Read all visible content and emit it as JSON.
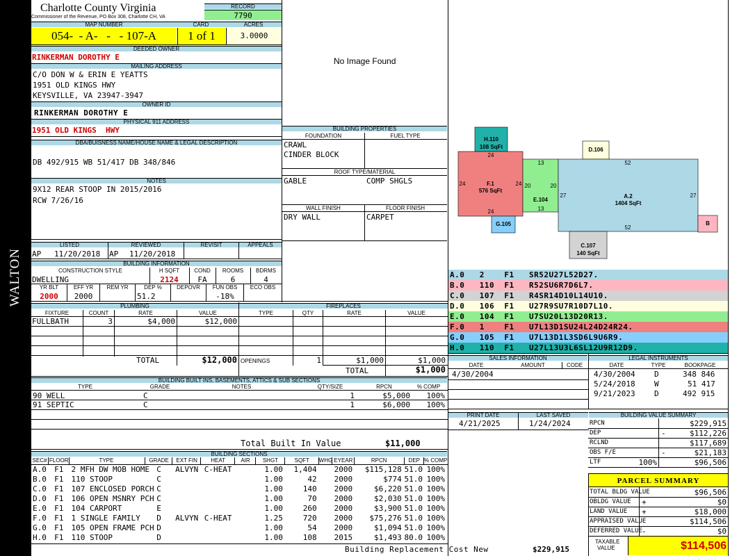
{
  "sidebar_label": "WALTON",
  "header": {
    "county": "Charlotte County Virginia",
    "commissioner": "Commissioner of the Revenue, PO Box 308, Charlotte CH, VA",
    "record_label": "RECORD",
    "record": "7790",
    "map_label": "MAP NUMBER",
    "map_number": "054-  - A-   -   - 107-A",
    "card_label": "CARD",
    "card": "1 of 1",
    "acres_label": "ACRES",
    "acres": "3.0000"
  },
  "owner": {
    "deeded_label": "DEEDED OWNER",
    "deeded": "RINKERMAN DOROTHY E",
    "mailing_label": "MAILING ADDRESS",
    "mailing": [
      "C/O DON W & ERIN E YEATTS",
      "1951 OLD KINGS HWY",
      "KEYSVILLE, VA 23947-3947"
    ],
    "owner_id_label": "OWNER ID",
    "owner_id": "RINKERMAN DOROTHY E",
    "physical_label": "PHYSICAL 911 ADDRESS",
    "physical": "1951 OLD KINGS  HWY",
    "dba_label": "DBA/BUISNESS NAME/HOUSE NAME & LEGAL DESCRIPTION",
    "dba": "DB 492/915 WB 51/417 DB 348/846",
    "notes_label": "NOTES",
    "notes": [
      "9X12 REAR STOOP IN 2015/2016",
      "RCW 7/26/16"
    ]
  },
  "image_placeholder": "No Image Found",
  "building_properties": {
    "title": "BUILDING PROPERTIES",
    "foundation_label": "FOUNDATION",
    "fuel_label": "FUEL TYPE",
    "foundation": [
      "CRAWL",
      "CINDER BLOCK"
    ],
    "roof_label": "ROOF TYPE/MATERIAL",
    "roof_type": "GABLE",
    "roof_material": "COMP SHGLS",
    "wall_label": "WALL FINISH",
    "floor_label": "FLOOR FINISH",
    "wall": "DRY WALL",
    "floor": "CARPET"
  },
  "dates": {
    "listed_label": "LISTED",
    "reviewed_label": "REVIEWED",
    "revisit_label": "REVISIT",
    "appeals_label": "APPEALS",
    "listed_by": "AP",
    "listed": "11/20/2018",
    "reviewed_by": "AP",
    "reviewed": "11/20/2018"
  },
  "building_info": {
    "title": "BUILDING INFORMATION",
    "style_label": "CONSTRUCTION STYLE",
    "hsqft_label": "H SQFT",
    "cond_label": "COND",
    "rooms_label": "ROOMS",
    "bdrms_label": "BDRMS",
    "style": "DWELLING",
    "hsqft": "2124",
    "cond": "FA",
    "rooms": "6",
    "bdrms": "4",
    "yrblt_label": "YR BLT",
    "effyr_label": "EFF YR",
    "remyr_label": "REM YR",
    "dep_label": "DEP %",
    "depovr_label": "DEPOVR",
    "funobs_label": "FUN OBS",
    "ecoobs_label": "ECO OBS",
    "yrblt": "2000",
    "effyr": "2000",
    "dep": "51.2",
    "funobs": "-18%"
  },
  "plumbing": {
    "title": "PLUMBING",
    "cols": [
      "FIXTURE",
      "COUNT",
      "RATE",
      "VALUE"
    ],
    "rows": [
      [
        "FULLBATH",
        "3",
        "$4,000",
        "$12,000"
      ]
    ],
    "total_label": "TOTAL",
    "total": "$12,000"
  },
  "fireplaces": {
    "title": "FIREPLACES",
    "cols": [
      "TYPE",
      "QTY",
      "RATE",
      "VALUE"
    ],
    "openings_label": "OPENINGS",
    "openings_qty": "1",
    "openings_rate": "$1,000",
    "openings_value": "$1,000",
    "total_label": "TOTAL",
    "total": "$1,000"
  },
  "sketch": {
    "labels": [
      {
        "code": "H.110",
        "area": "108 SqFt"
      },
      {
        "code": "D.106",
        "area": ""
      },
      {
        "code": "F.1",
        "area": "576 SqFt"
      },
      {
        "code": "E.104",
        "area": ""
      },
      {
        "code": "A.2",
        "area": "1404 SqFt"
      },
      {
        "code": "G.105",
        "area": ""
      },
      {
        "code": "B",
        "area": ""
      },
      {
        "code": "C.107",
        "area": "140 SqFt"
      }
    ],
    "dims": [
      "24",
      "24",
      "24",
      "24",
      "13",
      "13",
      "20",
      "20",
      "52",
      "52",
      "27",
      "27"
    ]
  },
  "sketch_legend": [
    {
      "text": "A.0   2    F1   SR52U27L52D27.",
      "color": "#add8e6"
    },
    {
      "text": "B.0   110  F1   R52SU6R7D6L7.",
      "color": "#ffb6c1"
    },
    {
      "text": "C.0   107  F1   R4SR14D10L14U10.",
      "color": "#d3d3d3"
    },
    {
      "text": "D.0   106  F1   U27R9SU7R10D7L10.",
      "color": "#ffffe0"
    },
    {
      "text": "E.0   104  F1   U7SU20L13D20R13.",
      "color": "#90ee90"
    },
    {
      "text": "F.0   1    F1   U7L13D1SU24L24D24R24.",
      "color": "#f08080"
    },
    {
      "text": "G.0   105  F1   U7L13D1L3SD6L9U6R9.",
      "color": "#87cefa"
    },
    {
      "text": "H.0   110  F1   U27L13U3L6SL12U9R12D9.",
      "color": "#20b2aa"
    }
  ],
  "sales": {
    "title": "SALES INFORMATION",
    "cols": [
      "DATE",
      "AMOUNT",
      "CODE"
    ],
    "rows": [
      [
        "4/30/2004",
        "",
        ""
      ]
    ]
  },
  "legal": {
    "title": "LEGAL INSTRUMENTS",
    "cols": [
      "DATE",
      "TYPE",
      "BOOKPAGE"
    ],
    "rows": [
      [
        "4/30/2004",
        "D",
        "348 846"
      ],
      [
        "5/24/2018",
        "W",
        "51 417"
      ],
      [
        "9/21/2023",
        "D",
        "492 915"
      ]
    ]
  },
  "print": {
    "print_label": "PRINT DATE",
    "saved_label": "LAST SAVED",
    "print_date": "4/21/2025",
    "saved_date": "1/24/2024"
  },
  "value_summary": {
    "title": "BUILDING VALUE SUMMARY",
    "rows": [
      {
        "label": "RPCN",
        "sign": "",
        "pct": "",
        "value": "$229,915"
      },
      {
        "label": "DEP",
        "sign": "-",
        "pct": "",
        "value": "$112,226"
      },
      {
        "label": "RCLND",
        "sign": "",
        "pct": "",
        "value": "$117,689"
      },
      {
        "label": "OBS F/E",
        "sign": "-",
        "pct": "",
        "value": "$21,183"
      },
      {
        "label": "LTF",
        "sign": "",
        "pct": "100%",
        "value": "$96,506"
      }
    ]
  },
  "parcel_summary": {
    "title": "PARCEL SUMMARY",
    "rows": [
      {
        "label": "TOTAL BLDG VALUE",
        "sign": "",
        "value": "$96,506"
      },
      {
        "label": "OBLDG VALUE",
        "sign": "+",
        "value": "$0"
      },
      {
        "label": "LAND VALUE",
        "sign": "+",
        "value": "$18,000"
      },
      {
        "label": "APPRAISED VALUE",
        "sign": "",
        "value": "$114,506"
      },
      {
        "label": "DEFERRED VALUE",
        "sign": "-",
        "value": "$0"
      }
    ],
    "taxable_label": [
      "TAXABLE",
      "VALUE"
    ],
    "taxable": "$114,506"
  },
  "built_ins": {
    "title": "BUILDING BUILT INS, BASEMENTS, ATTICS & SUB SECTIONS",
    "cols": [
      "TYPE",
      "GRADE",
      "NOTES",
      "QTY/SIZE",
      "RPCN",
      "% COMP"
    ],
    "rows": [
      [
        "90 WELL",
        "C",
        "",
        "1",
        "$5,000",
        "100%"
      ],
      [
        "91 SEPTIC",
        "C",
        "",
        "1",
        "$6,000",
        "100%"
      ]
    ],
    "total_label": "Total Built In Value",
    "total": "$11,000"
  },
  "sections": {
    "title": "BUILDING SECTIONS",
    "cols": [
      "SEC#",
      "FLOOR",
      "TYPE",
      "GRADE",
      "EXT FIN",
      "HEAT",
      "AIR",
      "SHGT",
      "SQFT",
      "WHGT",
      "EYEAR",
      "RPCN",
      "DEP",
      "% COMP"
    ],
    "rows": [
      [
        "A.0",
        "F1",
        "2 MFH DW MOB HOME",
        "C",
        "ALVYN",
        "C-HEAT",
        "",
        "1.00",
        "1,404",
        "",
        "2000",
        "$115,128",
        "51.0",
        "100%"
      ],
      [
        "B.0",
        "F1",
        "110 STOOP",
        "C",
        "",
        "",
        "",
        "1.00",
        "42",
        "",
        "2000",
        "$774",
        "51.0",
        "100%"
      ],
      [
        "C.0",
        "F1",
        "107 ENCLOSED PORCH",
        "C",
        "",
        "",
        "",
        "1.00",
        "140",
        "",
        "2000",
        "$6,220",
        "51.0",
        "100%"
      ],
      [
        "D.0",
        "F1",
        "106 OPEN MSNRY PCH",
        "C",
        "",
        "",
        "",
        "1.00",
        "70",
        "",
        "2000",
        "$2,030",
        "51.0",
        "100%"
      ],
      [
        "E.0",
        "F1",
        "104 CARPORT",
        "E",
        "",
        "",
        "",
        "1.00",
        "260",
        "",
        "2000",
        "$3,900",
        "51.0",
        "100%"
      ],
      [
        "F.0",
        "F1",
        "1 SINGLE FAMILY",
        "D",
        "ALVYN",
        "C-HEAT",
        "",
        "1.25",
        "720",
        "",
        "2000",
        "$75,276",
        "51.0",
        "100%"
      ],
      [
        "G.0",
        "F1",
        "105 OPEN FRAME PCH",
        "D",
        "",
        "",
        "",
        "1.00",
        "54",
        "",
        "2000",
        "$1,094",
        "51.0",
        "100%"
      ],
      [
        "H.0",
        "F1",
        "110 STOOP",
        "D",
        "",
        "",
        "",
        "1.00",
        "108",
        "",
        "2015",
        "$1,493",
        "80.0",
        "100%"
      ]
    ],
    "total_label": "Building Replacement Cost New",
    "total": "$229,915"
  }
}
